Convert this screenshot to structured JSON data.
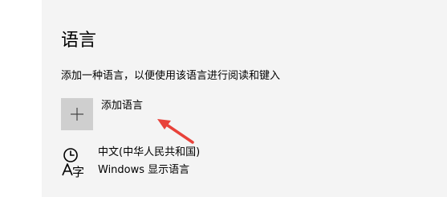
{
  "section": {
    "title": "语言",
    "description": "添加一种语言，以便使用该语言进行阅读和键入"
  },
  "add_language": {
    "label": "添加语言",
    "icon": "plus-icon"
  },
  "languages": [
    {
      "name": "中文(中华人民共和国)",
      "subtitle": "Windows 显示语言",
      "icon": "language-icon"
    }
  ],
  "annotation": {
    "icon": "red-arrow-icon",
    "color": "#e8423a"
  },
  "colors": {
    "background": "#f4f4f4",
    "tile": "#cfcfcf"
  }
}
